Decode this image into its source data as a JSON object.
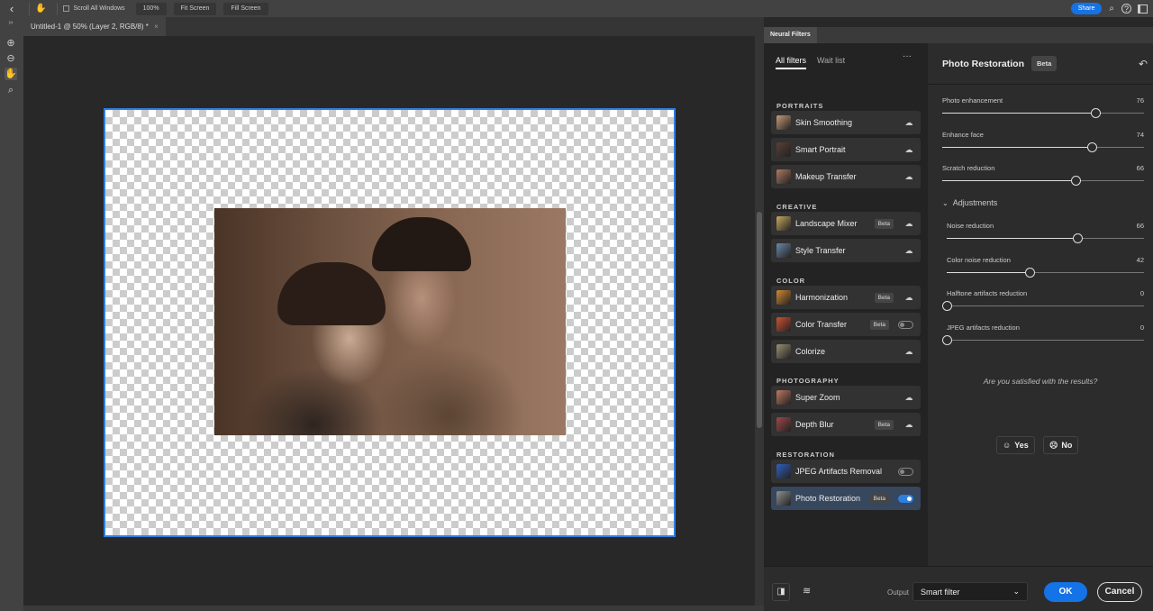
{
  "topbar": {
    "scroll_all_windows": "Scroll All Windows",
    "zoom_100": "100%",
    "fit_screen": "Fit Screen",
    "fill_screen": "Fill Screen",
    "share": "Share"
  },
  "document": {
    "tab_title": "Untitled-1 @ 50% (Layer 2, RGB/8) *",
    "close": "×"
  },
  "panel": {
    "tab": "Neural Filters",
    "tabs": [
      "All filters",
      "Wait list"
    ],
    "more": "···"
  },
  "filters": {
    "sections": [
      "PORTRAITS",
      "CREATIVE",
      "COLOR",
      "PHOTOGRAPHY",
      "RESTORATION"
    ],
    "items": [
      {
        "name": "Skin Smoothing",
        "beta": "",
        "state": "cloud",
        "thumb": "#c89a7a"
      },
      {
        "name": "Smart Portrait",
        "beta": "",
        "state": "cloud",
        "thumb": "#5a4038"
      },
      {
        "name": "Makeup Transfer",
        "beta": "",
        "state": "cloud",
        "thumb": "#b07a60"
      },
      {
        "name": "Landscape Mixer",
        "beta": "Beta",
        "state": "cloud",
        "thumb": "#c8a860"
      },
      {
        "name": "Style Transfer",
        "beta": "",
        "state": "cloud",
        "thumb": "#6a88a8"
      },
      {
        "name": "Harmonization",
        "beta": "Beta",
        "state": "cloud",
        "thumb": "#d08830"
      },
      {
        "name": "Color Transfer",
        "beta": "Beta",
        "state": "off",
        "thumb": "#d05030"
      },
      {
        "name": "Colorize",
        "beta": "",
        "state": "cloud",
        "thumb": "#9a9070"
      },
      {
        "name": "Super Zoom",
        "beta": "",
        "state": "cloud",
        "thumb": "#c07860"
      },
      {
        "name": "Depth Blur",
        "beta": "Beta",
        "state": "cloud",
        "thumb": "#a04848"
      },
      {
        "name": "JPEG Artifacts Removal",
        "beta": "",
        "state": "off",
        "thumb": "#3060c0"
      },
      {
        "name": "Photo Restoration",
        "beta": "Beta",
        "state": "on",
        "thumb": "#909090"
      }
    ]
  },
  "settings": {
    "title": "Photo Restoration",
    "beta": "Beta",
    "sliders": [
      {
        "label": "Photo enhancement",
        "value": 76
      },
      {
        "label": "Enhance face",
        "value": 74
      },
      {
        "label": "Scratch reduction",
        "value": 66
      }
    ],
    "adjustments_label": "Adjustments",
    "adjustments": [
      {
        "label": "Noise reduction",
        "value": 66
      },
      {
        "label": "Color noise reduction",
        "value": 42
      },
      {
        "label": "Halftone artifacts reduction",
        "value": 0
      },
      {
        "label": "JPEG artifacts reduction",
        "value": 0
      }
    ],
    "feedback_question": "Are you satisfied with the results?",
    "yes": "Yes",
    "no": "No"
  },
  "bottom": {
    "output_label": "Output",
    "output_value": "Smart filter",
    "ok": "OK",
    "cancel": "Cancel"
  },
  "colors": {
    "accent": "#2f7fe0"
  }
}
